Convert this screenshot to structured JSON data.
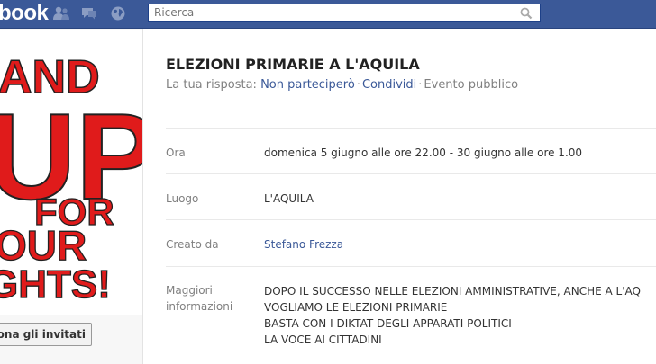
{
  "topbar": {
    "logo": "book",
    "search_placeholder": "Ricerca"
  },
  "left": {
    "poster_lines": [
      "AND",
      "UP",
      "FOR",
      "OUR",
      "GHTS!"
    ],
    "invite_button": "ona gli invitati"
  },
  "event": {
    "title": "ELEZIONI PRIMARIE A L'AQUILA",
    "response_label": "La tua risposta:",
    "response_value": "Non parteciperò",
    "share": "Condividi",
    "event_type": "Evento pubblico",
    "rows": {
      "time": {
        "label": "Ora",
        "value": "domenica 5 giugno alle ore 22.00 - 30 giugno alle ore 1.00"
      },
      "place": {
        "label": "Luogo",
        "value": "L'AQUILA"
      },
      "creator": {
        "label": "Creato da",
        "value": "Stefano Frezza"
      },
      "info": {
        "label_line1": "Maggiori",
        "label_line2": "informazioni",
        "lines": [
          "DOPO IL SUCCESSO NELLE ELEZIONI AMMINISTRATIVE, ANCHE A L'AQ",
          "VOGLIAMO LE ELEZIONI PRIMARIE",
          "BASTA CON I DIKTAT DEGLI APPARATI POLITICI",
          "LA VOCE AI CITTADINI"
        ]
      }
    }
  },
  "colors": {
    "brand": "#3b5998",
    "poster_red": "#e01b1b"
  }
}
